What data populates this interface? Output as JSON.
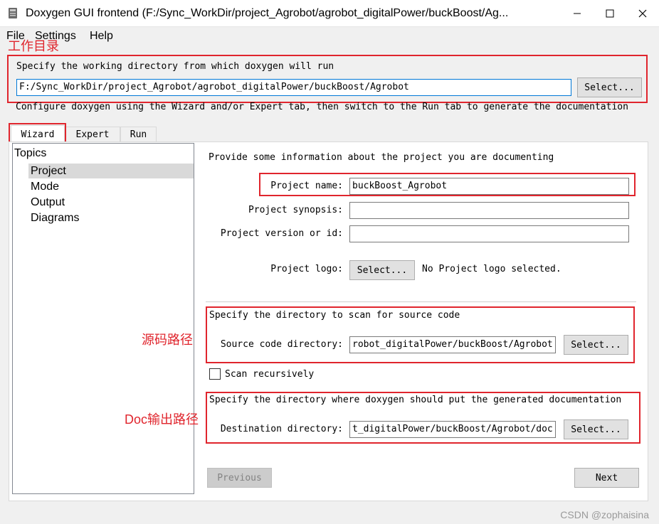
{
  "window": {
    "title": "Doxygen GUI frontend (F:/Sync_WorkDir/project_Agrobot/agrobot_digitalPower/buckBoost/Ag..."
  },
  "menu": {
    "items": [
      "File",
      "Settings",
      "Help"
    ]
  },
  "annotations": {
    "workdir": "工作目录",
    "source": "源码路径",
    "doc_output": "Doc输出路径",
    "color": "#e0252d"
  },
  "workdir": {
    "prompt": "Specify the working directory from which doxygen will run",
    "value": "F:/Sync_WorkDir/project_Agrobot/agrobot_digitalPower/buckBoost/Agrobot",
    "select_label": "Select..."
  },
  "configure_hint": "Configure doxygen using the Wizard and/or Expert tab, then switch to the Run tab to generate the documentation",
  "tabs": [
    {
      "label": "Wizard",
      "active": true
    },
    {
      "label": "Expert",
      "active": false
    },
    {
      "label": "Run",
      "active": false
    }
  ],
  "topics": {
    "header": "Topics",
    "items": [
      "Project",
      "Mode",
      "Output",
      "Diagrams"
    ],
    "selected": "Project"
  },
  "project": {
    "intro": "Provide some information about the project you are documenting",
    "name_label": "Project name:",
    "name_value": "buckBoost_Agrobot",
    "synopsis_label": "Project synopsis:",
    "synopsis_value": "",
    "version_label": "Project version or id:",
    "version_value": "",
    "logo_label": "Project logo:",
    "logo_button": "Select...",
    "logo_status": "No Project logo selected."
  },
  "source": {
    "intro": "Specify the directory to scan for source code",
    "label": "Source code directory:",
    "value": "robot_digitalPower/buckBoost/Agrobot",
    "select_label": "Select...",
    "recursive_label": "Scan recursively",
    "recursive_checked": false
  },
  "destination": {
    "intro": "Specify the directory where doxygen should put the generated documentation",
    "label": "Destination directory:",
    "value": "t_digitalPower/buckBoost/Agrobot/doc",
    "select_label": "Select..."
  },
  "nav": {
    "previous": "Previous",
    "next": "Next"
  },
  "watermark": "CSDN @zophaisina"
}
